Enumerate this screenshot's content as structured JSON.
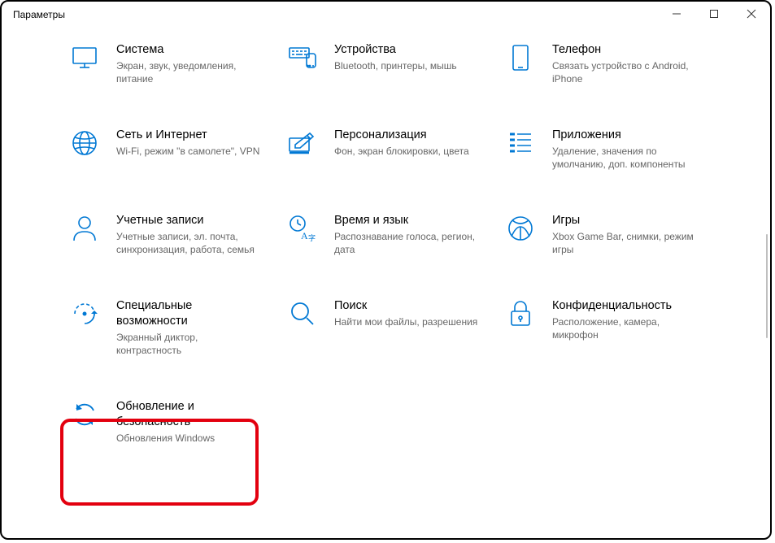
{
  "window": {
    "title": "Параметры"
  },
  "tiles": {
    "system": {
      "title": "Система",
      "sub": "Экран, звук, уведомления, питание"
    },
    "devices": {
      "title": "Устройства",
      "sub": "Bluetooth, принтеры, мышь"
    },
    "phone": {
      "title": "Телефон",
      "sub": "Связать устройство с Android, iPhone"
    },
    "network": {
      "title": "Сеть и Интернет",
      "sub": "Wi-Fi, режим \"в самолете\", VPN"
    },
    "personalization": {
      "title": "Персонализация",
      "sub": "Фон, экран блокировки, цвета"
    },
    "apps": {
      "title": "Приложения",
      "sub": "Удаление, значения по умолчанию, доп. компоненты"
    },
    "accounts": {
      "title": "Учетные записи",
      "sub": "Учетные записи, эл. почта, синхронизация, работа, семья"
    },
    "time": {
      "title": "Время и язык",
      "sub": "Распознавание голоса, регион, дата"
    },
    "gaming": {
      "title": "Игры",
      "sub": "Xbox Game Bar, снимки, режим игры"
    },
    "accessibility": {
      "title": "Специальные возможности",
      "sub": "Экранный диктор, контрастность"
    },
    "search": {
      "title": "Поиск",
      "sub": "Найти мои файлы, разрешения"
    },
    "privacy": {
      "title": "Конфиденциальность",
      "sub": "Расположение, камера, микрофон"
    },
    "update": {
      "title": "Обновление и безопасность",
      "sub": "Обновления Windows"
    }
  }
}
